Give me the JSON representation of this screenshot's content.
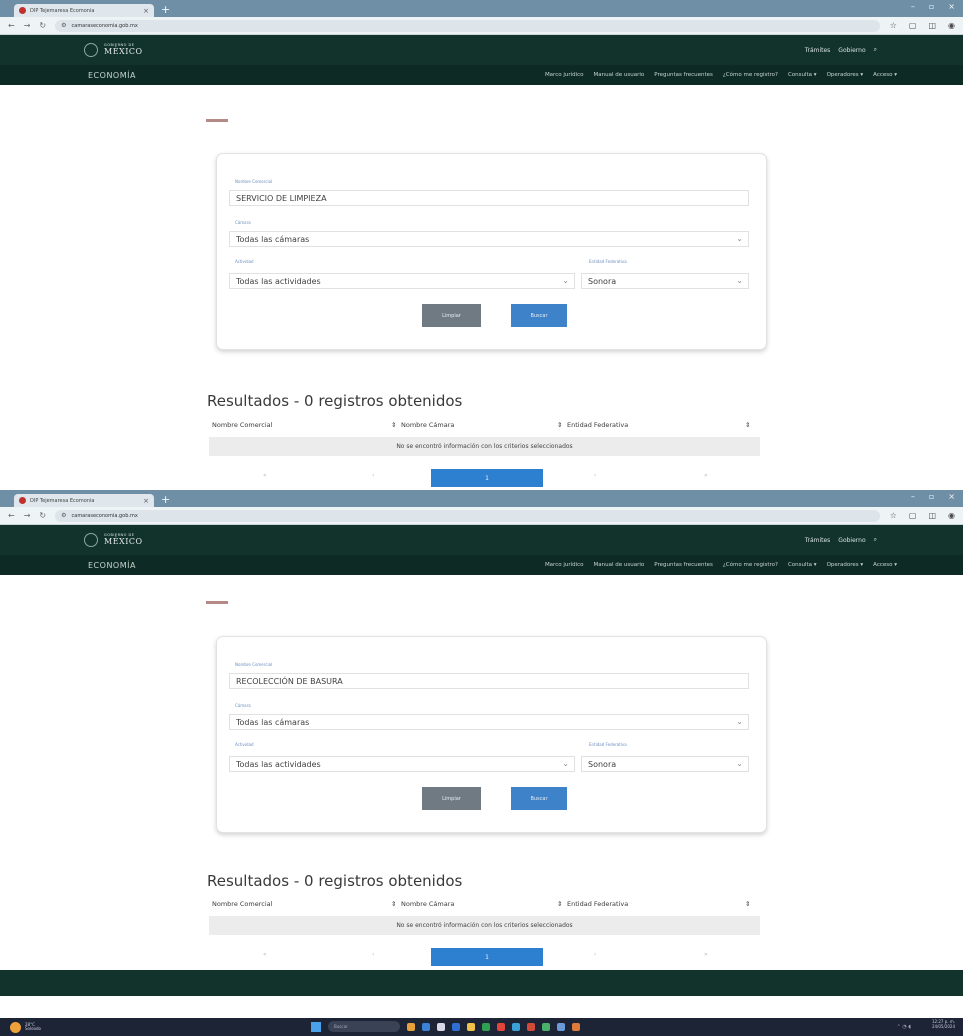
{
  "browser": {
    "tab_title": "DIP Tejemaresa Ecomonia",
    "tab_close": "×",
    "new_tab": "+",
    "url": "camaraseconomia.gob.mx",
    "window_controls": [
      "–",
      "▫",
      "×"
    ],
    "right_icons": [
      "☆",
      "▢",
      "◫",
      "◉"
    ]
  },
  "header": {
    "logo_small": "GOBIERNO DE",
    "logo_big": "MÉXICO",
    "top_links": [
      "Trámites",
      "Gobierno"
    ],
    "brand": "ECONOMÍA",
    "menu": [
      "Marco jurídico",
      "Manual de usuario",
      "Preguntas frecuentes",
      "¿Cómo me registro?",
      "Consulta ▾",
      "Operadores ▾",
      "Acceso ▾"
    ]
  },
  "form_labels": {
    "nombre": "Nombre Comercial",
    "camara": "Cámara",
    "actividad": "Actividad",
    "entidad": "Entidad Federativa"
  },
  "buttons": {
    "clear": "Limpiar",
    "search": "Buscar"
  },
  "results": {
    "title": "Resultados - 0 registros obtenidos",
    "columns": [
      "Nombre Comercial",
      "Nombre Cámara",
      "Entidad Federativa"
    ],
    "sort_marks": [
      "⇕",
      "⇕",
      "⇕"
    ],
    "empty": "No se encontró información con los criterios seleccionados",
    "pages": [
      "«",
      "‹",
      "1",
      "›",
      "»"
    ]
  },
  "screens": [
    {
      "nombre_value": "SERVICIO DE LIMPIEZA",
      "camara_value": "Todas las cámaras",
      "actividad_value": "Todas las actividades",
      "entidad_value": "Sonora"
    },
    {
      "nombre_value": "RECOLECCIÓN DE BASURA",
      "camara_value": "Todas las cámaras",
      "actividad_value": "Todas las actividades",
      "entidad_value": "Sonora"
    }
  ],
  "taskbar": {
    "weather_temp": "28°C",
    "weather_desc": "Soleado",
    "search_placeholder": "Buscar",
    "time": "12:27 p. m.",
    "date": "24/05/2024"
  },
  "colors": {
    "header_dark": "#11332c",
    "nav_dark": "#0d2a24",
    "search_button": "#3e82c9",
    "clear_button": "#6f7a82",
    "label_blue": "#6b8fc0",
    "pager_active": "#2d7fd0"
  }
}
